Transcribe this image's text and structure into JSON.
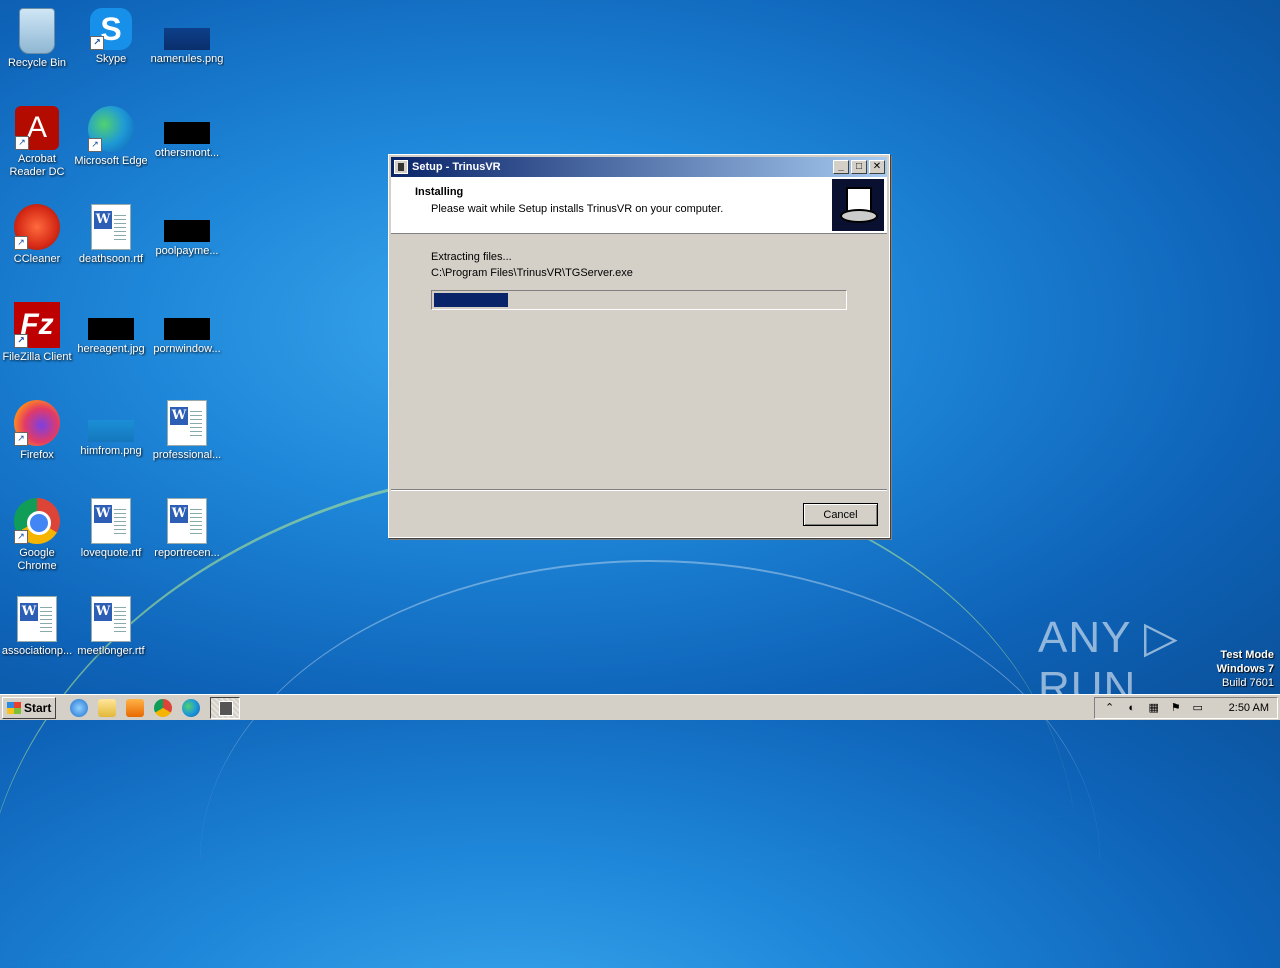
{
  "desktop": {
    "icons": [
      {
        "label": "Recycle Bin"
      },
      {
        "label": "Skype"
      },
      {
        "label": "namerules.png"
      },
      {
        "label": "Acrobat Reader DC"
      },
      {
        "label": "Microsoft Edge"
      },
      {
        "label": "othersmont..."
      },
      {
        "label": "CCleaner"
      },
      {
        "label": "deathsoon.rtf"
      },
      {
        "label": "poolpayme..."
      },
      {
        "label": "FileZilla Client"
      },
      {
        "label": "hereagent.jpg"
      },
      {
        "label": "pornwindow..."
      },
      {
        "label": "Firefox"
      },
      {
        "label": "himfrom.png"
      },
      {
        "label": "professional..."
      },
      {
        "label": "Google Chrome"
      },
      {
        "label": "lovequote.rtf"
      },
      {
        "label": "reportrecen..."
      },
      {
        "label": "associationp..."
      },
      {
        "label": "meetlonger.rtf"
      }
    ]
  },
  "setup": {
    "title": "Setup - TrinusVR",
    "heading": "Installing",
    "subheading": "Please wait while Setup installs TrinusVR on your computer.",
    "status": "Extracting files...",
    "path": "C:\\Program Files\\TrinusVR\\TGServer.exe",
    "progress_percent": 18,
    "cancel_label": "Cancel",
    "minimize_glyph": "_",
    "maximize_glyph": "□",
    "close_glyph": "✕"
  },
  "watermark": {
    "text": "ANY ▷ RUN",
    "mode": "Test Mode",
    "os": "Windows 7",
    "build": "Build 7601"
  },
  "taskbar": {
    "start_label": "Start",
    "clock": "2:50 AM",
    "tray_expand_glyph": "⌃"
  }
}
